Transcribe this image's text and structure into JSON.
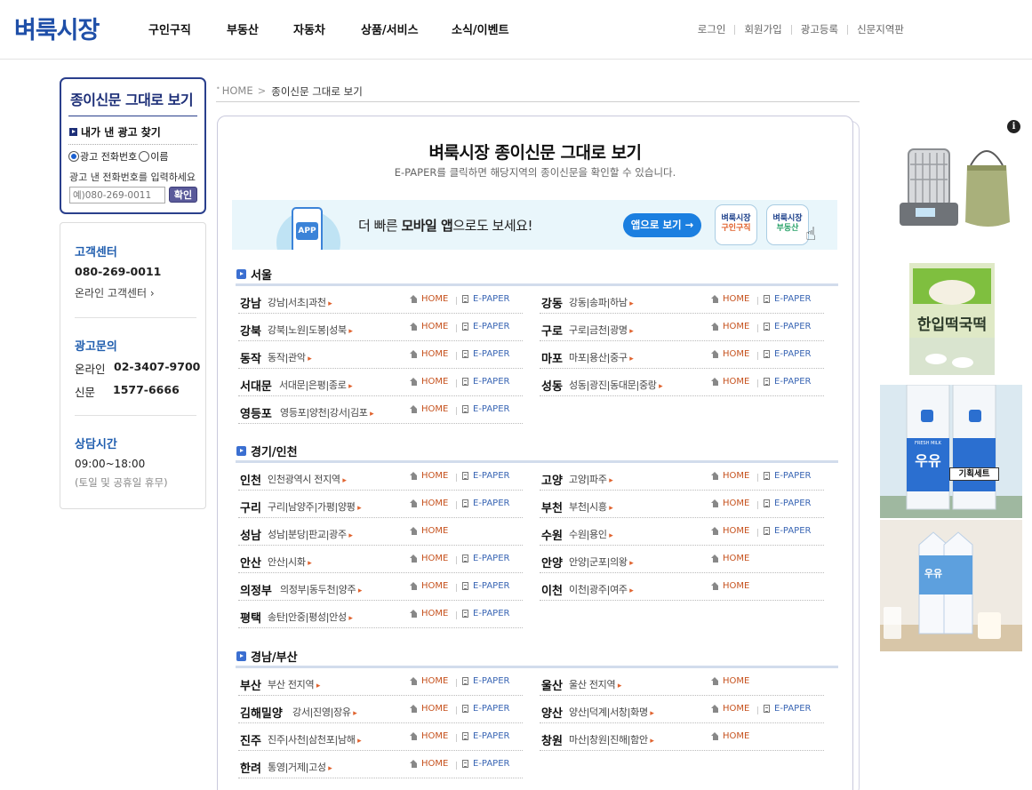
{
  "header": {
    "logo": "벼룩시장",
    "menu": [
      "구인구직",
      "부동산",
      "자동차",
      "상품/서비스",
      "소식/이벤트"
    ],
    "util": [
      "로그인",
      "회원가입",
      "광고등록",
      "신문지역판"
    ]
  },
  "my_ad": {
    "title": "종이신문 그대로 보기",
    "subtitle": "내가 낸 광고 찾기",
    "radio_phone": "광고 전화번호",
    "radio_name": "이름",
    "hint": "광고 낸 전화번호를 입력하세요",
    "input_placeholder": "예)080-269-0011",
    "confirm": "확인"
  },
  "customer": {
    "cs_title": "고객센터",
    "cs_phone": "080-269-0011",
    "cs_online": "온라인 고객센터 ›",
    "ad_title": "광고문의",
    "ad_online_label": "온라인",
    "ad_online_num": "02-3407-9700",
    "ad_paper_label": "신문",
    "ad_paper_num": "1577-6666",
    "hours_title": "상담시간",
    "hours": "09:00~18:00",
    "hours_note": "(토일 및 공휴일 휴무)"
  },
  "breadcrumb": {
    "home": "HOME",
    "current": "종이신문 그대로 보기"
  },
  "page": {
    "title": "벼룩시장 종이신문 그대로 보기",
    "subtitle": "E-PAPER를 클릭하면 해당지역의 종이신문을 확인할 수 있습니다."
  },
  "banner": {
    "app_label": "APP",
    "msg_pre": "더 빠른 ",
    "msg_bold": "모바일 앱",
    "msg_post": "으로도 보세요!",
    "button": "앱으로 보기 →",
    "tile1_brand": "벼룩시장",
    "tile1_sub": "구인구직",
    "tile2_brand": "벼룩시장",
    "tile2_sub": "부동산"
  },
  "labels": {
    "home": "HOME",
    "epaper": "E-PAPER"
  },
  "sections": [
    {
      "name": "서울",
      "rows": [
        [
          {
            "name": "강남",
            "areas": "강남|서초|과천",
            "epaper": true
          },
          {
            "name": "강동",
            "areas": "강동|송파|하남",
            "epaper": true
          }
        ],
        [
          {
            "name": "강북",
            "areas": "강북|노원|도봉|성북",
            "epaper": true
          },
          {
            "name": "구로",
            "areas": "구로|금천|광명",
            "epaper": true
          }
        ],
        [
          {
            "name": "동작",
            "areas": "동작|관악",
            "epaper": true
          },
          {
            "name": "마포",
            "areas": "마포|용산|중구",
            "epaper": true
          }
        ],
        [
          {
            "name": "서대문",
            "areas": "서대문|은평|종로",
            "epaper": true
          },
          {
            "name": "성동",
            "areas": "성동|광진|동대문|중랑",
            "epaper": true
          }
        ],
        [
          {
            "name": "영등포",
            "areas": "영등포|양천|강서|김포",
            "epaper": true
          },
          null
        ]
      ]
    },
    {
      "name": "경기/인천",
      "rows": [
        [
          {
            "name": "인천",
            "areas": "인천광역시 전지역",
            "epaper": true
          },
          {
            "name": "고양",
            "areas": "고양|파주",
            "epaper": true
          }
        ],
        [
          {
            "name": "구리",
            "areas": "구리|남양주|가평|양평",
            "epaper": true
          },
          {
            "name": "부천",
            "areas": "부천|시흥",
            "epaper": true
          }
        ],
        [
          {
            "name": "성남",
            "areas": "성남|분당|판교|광주",
            "epaper": false
          },
          {
            "name": "수원",
            "areas": "수원|용인",
            "epaper": true
          }
        ],
        [
          {
            "name": "안산",
            "areas": "안산|시화",
            "epaper": true
          },
          {
            "name": "안양",
            "areas": "안양|군포|의왕",
            "epaper": false
          }
        ],
        [
          {
            "name": "의정부",
            "areas": "의정부|동두천|양주",
            "epaper": true
          },
          {
            "name": "이천",
            "areas": "이천|광주|여주",
            "epaper": false
          }
        ],
        [
          {
            "name": "평택",
            "areas": "송탄|안중|평성|안성",
            "epaper": true
          },
          null
        ]
      ]
    },
    {
      "name": "경남/부산",
      "rows": [
        [
          {
            "name": "부산",
            "areas": "부산 전지역",
            "epaper": true
          },
          {
            "name": "울산",
            "areas": "울산 전지역",
            "epaper": false
          }
        ],
        [
          {
            "name": "김해밀양",
            "areas": "강서|진영|장유",
            "epaper": true
          },
          {
            "name": "양산",
            "areas": "양산|덕계|서창|화명",
            "epaper": true
          }
        ],
        [
          {
            "name": "진주",
            "areas": "진주|사천|삼천포|남해",
            "epaper": true
          },
          {
            "name": "창원",
            "areas": "마산|창원|진해|함안",
            "epaper": false
          }
        ],
        [
          {
            "name": "한려",
            "areas": "통영|거제|고성",
            "epaper": true
          },
          null
        ]
      ]
    }
  ],
  "ads": {
    "info": "i",
    "milk1_brand": "우유",
    "milk1_tag": "기획세트",
    "milk1_sub": "FRESH MILK",
    "milk2_brand": "우유",
    "rice_cake": "한입떡국떡"
  }
}
